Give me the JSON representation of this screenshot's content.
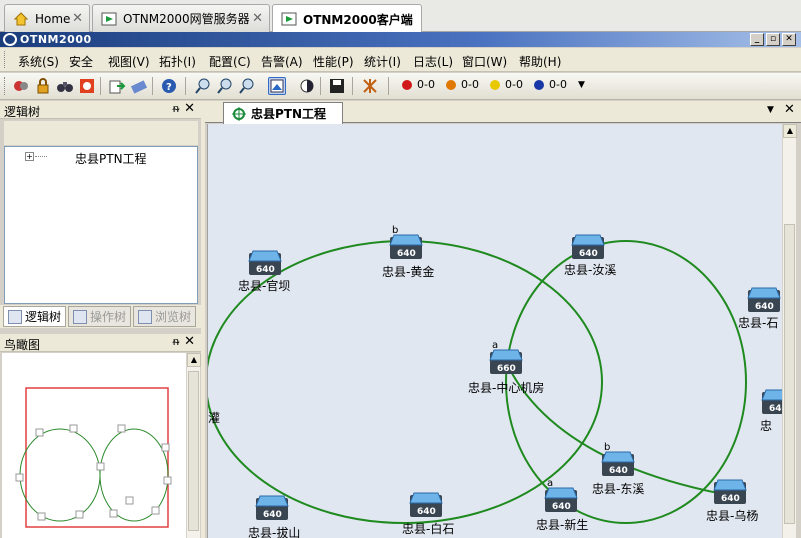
{
  "browser_tabs": [
    {
      "label": "Home"
    },
    {
      "label": "OTNM2000网管服务器"
    },
    {
      "label": "OTNM2000客户端"
    }
  ],
  "window": {
    "title": "OTNM2000"
  },
  "menu": [
    "系统(S)",
    "安全",
    "视图(V)",
    "拓扑(I)",
    "配置(C)",
    "告警(A)",
    "性能(P)",
    "统计(I)",
    "日志(L)",
    "窗口(W)",
    "帮助(H)"
  ],
  "alarms": [
    {
      "color": "#d01818",
      "label": "0-0"
    },
    {
      "color": "#e07800",
      "label": "0-0"
    },
    {
      "color": "#e8c800",
      "label": "0-0"
    },
    {
      "color": "#1838a8",
      "label": "0-0"
    }
  ],
  "left_panel": {
    "title": "逻辑树",
    "tree_root": "忠县PTN工程",
    "tabs": [
      "逻辑树",
      "操作树",
      "浏览树"
    ]
  },
  "bird_panel": {
    "title": "鸟瞰图"
  },
  "doc_tab": {
    "label": "忠县PTN工程"
  },
  "topology": {
    "nodes": [
      {
        "label": "忠县-官坝",
        "model": "640",
        "port": ""
      },
      {
        "label": "忠县-黄金",
        "model": "640",
        "port": "b"
      },
      {
        "label": "忠县-汝溪",
        "model": "640",
        "port": ""
      },
      {
        "label": "忠县-石",
        "model": "640",
        "port": ""
      },
      {
        "label": "忠县-中心机房",
        "model": "660",
        "port": "a"
      },
      {
        "label": "忠",
        "model": "640",
        "port": ""
      },
      {
        "label": "忠县-东溪",
        "model": "640",
        "port": "b"
      },
      {
        "label": "忠县-乌杨",
        "model": "640",
        "port": ""
      },
      {
        "label": "忠县-新生",
        "model": "640",
        "port": "a"
      },
      {
        "label": "忠县-白石",
        "model": "640",
        "port": ""
      },
      {
        "label": "忠县-拔山",
        "model": "640",
        "port": ""
      },
      {
        "label": "灌",
        "model": "",
        "port": ""
      }
    ]
  }
}
